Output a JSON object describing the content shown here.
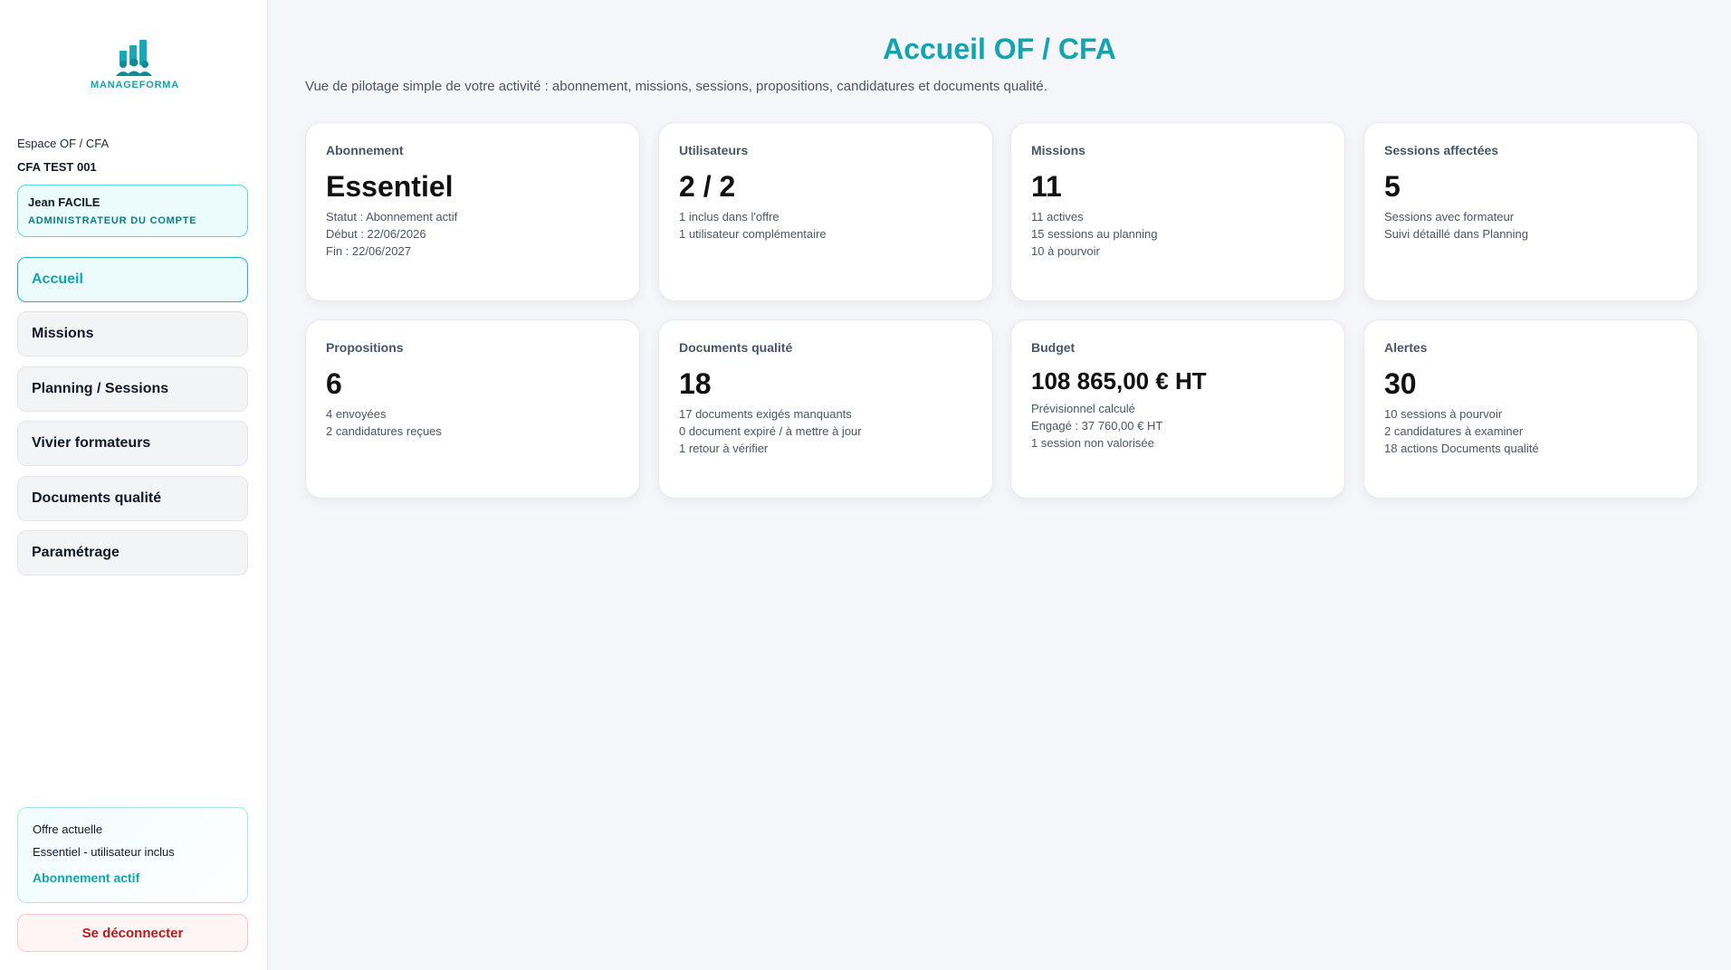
{
  "brand": {
    "name": "MANAGEFORMA",
    "color": "#14a3b0"
  },
  "sidebar": {
    "space_label": "Espace OF / CFA",
    "space_name": "CFA TEST 001",
    "user": {
      "name": "Jean FACILE",
      "role": "ADMINISTRATEUR DU COMPTE"
    },
    "nav": [
      {
        "label": "Accueil",
        "active": true
      },
      {
        "label": "Missions",
        "active": false
      },
      {
        "label": "Planning / Sessions",
        "active": false
      },
      {
        "label": "Vivier formateurs",
        "active": false
      },
      {
        "label": "Documents qualité",
        "active": false
      },
      {
        "label": "Paramétrage",
        "active": false
      }
    ],
    "offer": {
      "title": "Offre actuelle",
      "plan": "Essentiel - utilisateur inclus",
      "status": "Abonnement actif"
    },
    "logout_label": "Se déconnecter"
  },
  "main": {
    "title": "Accueil OF / CFA",
    "subtitle": "Vue de pilotage simple de votre activité : abonnement, missions, sessions, propositions, candidatures et documents qualité.",
    "cards": [
      {
        "label": "Abonnement",
        "value": "Essentiel",
        "lines": [
          "Statut : Abonnement actif",
          "Début : 22/06/2026",
          "Fin : 22/06/2027"
        ]
      },
      {
        "label": "Utilisateurs",
        "value": "2 / 2",
        "lines": [
          "1 inclus dans l'offre",
          "1 utilisateur complémentaire"
        ]
      },
      {
        "label": "Missions",
        "value": "11",
        "lines": [
          "11 actives",
          "15 sessions au planning",
          "10 à pourvoir"
        ]
      },
      {
        "label": "Sessions affectées",
        "value": "5",
        "lines": [
          "Sessions avec formateur",
          "Suivi détaillé dans Planning"
        ]
      },
      {
        "label": "Propositions",
        "value": "6",
        "lines": [
          "4 envoyées",
          "2 candidatures reçues"
        ]
      },
      {
        "label": "Documents qualité",
        "value": "18",
        "lines": [
          "17 documents exigés manquants",
          "0 document expiré / à mettre à jour",
          "1 retour à vérifier"
        ]
      },
      {
        "label": "Budget",
        "value": "108 865,00 € HT",
        "lines": [
          "Prévisionnel calculé",
          "Engagé : 37 760,00 € HT",
          "1 session non valorisée"
        ]
      },
      {
        "label": "Alertes",
        "value": "30",
        "lines": [
          "10 sessions à pourvoir",
          "2 candidatures à examiner",
          "18 actions Documents qualité"
        ]
      }
    ]
  }
}
